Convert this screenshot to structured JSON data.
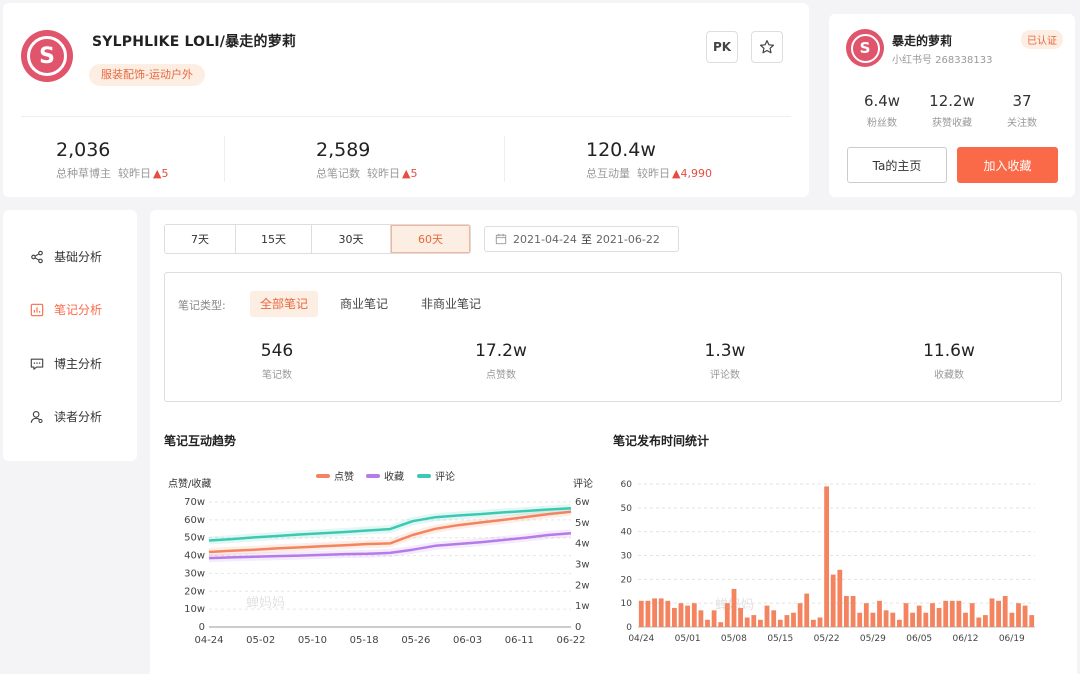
{
  "profile": {
    "brand_name": "SYLPHLIKE LOLI/暴走的萝莉",
    "category_tag": "服装配饰-运动户外",
    "pk_label": "PK",
    "stats": [
      {
        "value": "2,036",
        "label": "总种草博主",
        "compare_label": "较昨日",
        "delta": "5"
      },
      {
        "value": "2,589",
        "label": "总笔记数",
        "compare_label": "较昨日",
        "delta": "5"
      },
      {
        "value": "120.4w",
        "label": "总互动量",
        "compare_label": "较昨日",
        "delta": "4,990"
      }
    ]
  },
  "user_card": {
    "name": "暴走的萝莉",
    "id_text": "小红书号  268338133",
    "badge": "已认证",
    "stats": [
      {
        "value": "6.4w",
        "label": "粉丝数"
      },
      {
        "value": "12.2w",
        "label": "获赞收藏"
      },
      {
        "value": "37",
        "label": "关注数"
      }
    ],
    "home_button": "Ta的主页",
    "fav_button": "加入收藏"
  },
  "sidebar": {
    "items": [
      {
        "label": "基础分析",
        "icon": "share-icon"
      },
      {
        "label": "笔记分析",
        "icon": "bar-chart-icon"
      },
      {
        "label": "博主分析",
        "icon": "message-icon"
      },
      {
        "label": "读者分析",
        "icon": "user-icon"
      }
    ]
  },
  "main": {
    "ranges": [
      "7天",
      "15天",
      "30天",
      "60天"
    ],
    "active_range": "60天",
    "date_start": "2021-04-24",
    "date_sep": "至",
    "date_end": "2021-06-22",
    "filter_label": "笔记类型:",
    "filters": [
      "全部笔记",
      "商业笔记",
      "非商业笔记"
    ],
    "note_stats": [
      {
        "value": "546",
        "label": "笔记数"
      },
      {
        "value": "17.2w",
        "label": "点赞数"
      },
      {
        "value": "1.3w",
        "label": "评论数"
      },
      {
        "value": "11.6w",
        "label": "收藏数"
      }
    ],
    "trend_title": "笔记互动趋势",
    "publish_title": "笔记发布时间统计"
  },
  "colors": {
    "accent": "#fa6a48",
    "likes": "#f4845f",
    "favs": "#b57be8",
    "comments": "#3cc9b2",
    "bar": "#f4845f"
  },
  "chart_data": [
    {
      "type": "line",
      "title": "笔记互动趋势",
      "ylabel": "点赞/收藏",
      "y2label": "评论",
      "legend_position": "top",
      "watermark": "蝉妈妈",
      "x_ticks": [
        "04-24",
        "05-02",
        "05-10",
        "05-18",
        "05-26",
        "06-03",
        "06-11",
        "06-22"
      ],
      "ylim": [
        0,
        70
      ],
      "y_ticks": [
        "0",
        "10w",
        "20w",
        "30w",
        "40w",
        "50w",
        "60w",
        "70w"
      ],
      "y2lim": [
        0,
        6
      ],
      "y2_ticks": [
        "0",
        "1w",
        "2w",
        "3w",
        "4w",
        "5w",
        "6w"
      ],
      "series": [
        {
          "name": "点赞",
          "axis": "left",
          "values": [
            42,
            42.7,
            43.3,
            44,
            44.6,
            45.2,
            45.8,
            46.5,
            46.8,
            51.5,
            55,
            57,
            58.5,
            60,
            61.6,
            63.2,
            64.5
          ]
        },
        {
          "name": "收藏",
          "axis": "left",
          "values": [
            38.6,
            39,
            39.3,
            39.7,
            40,
            40.4,
            40.8,
            41,
            41.5,
            43.3,
            45.5,
            46.5,
            47.5,
            48.7,
            50,
            51.5,
            52.5
          ]
        },
        {
          "name": "评论",
          "axis": "right",
          "values": [
            4.15,
            4.22,
            4.3,
            4.37,
            4.44,
            4.5,
            4.56,
            4.63,
            4.7,
            5.08,
            5.27,
            5.35,
            5.42,
            5.5,
            5.57,
            5.64,
            5.7
          ]
        }
      ]
    },
    {
      "type": "bar",
      "title": "笔记发布时间统计",
      "x_ticks": [
        "04/24",
        "05/01",
        "05/08",
        "05/15",
        "05/22",
        "05/29",
        "06/05",
        "06/12",
        "06/19"
      ],
      "ylim": [
        0,
        60
      ],
      "y_ticks": [
        "0",
        "10",
        "20",
        "30",
        "40",
        "50",
        "60"
      ],
      "watermark": "蝉妈妈",
      "values": [
        11,
        11,
        12,
        12,
        11,
        8,
        10,
        9,
        10,
        7,
        3,
        7,
        2,
        10,
        16,
        8,
        4,
        5,
        3,
        9,
        7,
        3,
        5,
        6,
        10,
        14,
        3,
        4,
        59,
        22,
        24,
        13,
        13,
        6,
        10,
        6,
        11,
        7,
        6,
        3,
        10,
        6,
        9,
        6,
        10,
        8,
        11,
        11,
        11,
        6,
        10,
        4,
        5,
        12,
        11,
        13,
        6,
        10,
        9,
        5
      ]
    }
  ]
}
